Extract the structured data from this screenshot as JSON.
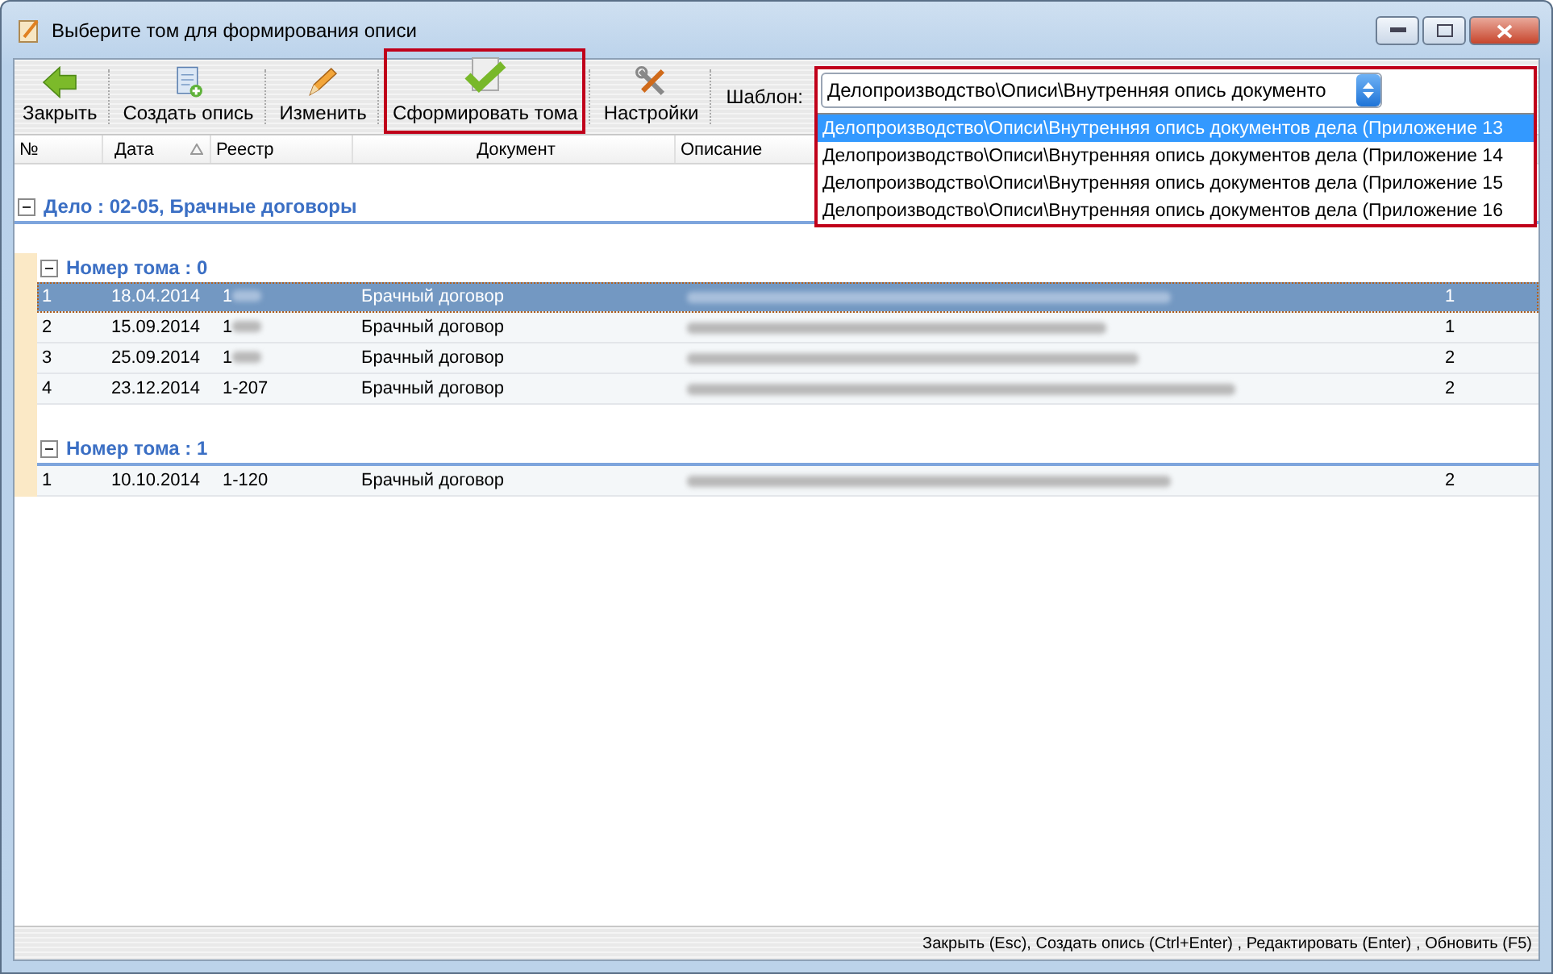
{
  "window": {
    "title": "Выберите том для формирования описи"
  },
  "toolbar": {
    "buttons": [
      {
        "kind": "back",
        "label": "Закрыть",
        "highlighted": false
      },
      {
        "kind": "create",
        "label": "Создать опись",
        "highlighted": false
      },
      {
        "kind": "edit",
        "label": "Изменить",
        "highlighted": false
      },
      {
        "kind": "form",
        "label": "Сформировать тома",
        "highlighted": true
      },
      {
        "kind": "settings",
        "label": "Настройки",
        "highlighted": false
      }
    ],
    "template": {
      "label": "Шаблон:",
      "value": "Делопроизводство\\Описи\\Внутренняя опись документо",
      "expanded": true,
      "highlighted": true,
      "options": [
        {
          "label": "Делопроизводство\\Описи\\Внутренняя опись документов дела (Приложение 13",
          "selected": true
        },
        {
          "label": "Делопроизводство\\Описи\\Внутренняя опись документов дела (Приложение 14",
          "selected": false
        },
        {
          "label": "Делопроизводство\\Описи\\Внутренняя опись документов дела (Приложение 15",
          "selected": false
        },
        {
          "label": "Делопроизводство\\Описи\\Внутренняя опись документов дела (Приложение 16",
          "selected": false
        }
      ]
    }
  },
  "table": {
    "columns": [
      {
        "label": "№",
        "sorted": false
      },
      {
        "label": "Дата",
        "sorted": true
      },
      {
        "label": "Реестр",
        "sorted": false
      },
      {
        "label": "Документ",
        "sorted": false
      },
      {
        "label": "Описание",
        "sorted": false
      }
    ],
    "groups": [
      {
        "label": "Дело : 02-05, Брачные договоры",
        "expanded": true,
        "children": [
          {
            "label": "Номер тома : 0",
            "expanded": true,
            "rows": [
              {
                "number": "1",
                "date": "18.04.2014",
                "registry": "1",
                "registry_redacted": true,
                "document": "Брачный договор",
                "description_redacted": true,
                "column_6": "1",
                "selected": true
              },
              {
                "number": "2",
                "date": "15.09.2014",
                "registry": "1",
                "registry_redacted": true,
                "document": "Брачный договор",
                "description_redacted": true,
                "column_6": "1",
                "selected": false
              },
              {
                "number": "3",
                "date": "25.09.2014",
                "registry": "1",
                "registry_redacted": true,
                "document": "Брачный договор",
                "description_redacted": true,
                "column_6": "2",
                "selected": false
              },
              {
                "number": "4",
                "date": "23.12.2014",
                "registry": "1-207",
                "registry_redacted": false,
                "document": "Брачный договор",
                "description_redacted": true,
                "column_6": "2",
                "selected": false
              }
            ]
          },
          {
            "label": "Номер тома : 1",
            "expanded": true,
            "rows": [
              {
                "number": "1",
                "date": "10.10.2014",
                "registry": "1-120",
                "registry_redacted": false,
                "document": "Брачный договор",
                "description_redacted": true,
                "column_6": "2",
                "selected": false
              }
            ]
          }
        ]
      }
    ]
  },
  "status_bar": "Закрыть (Esc), Создать опись (Ctrl+Enter) , Редактировать (Enter) , Обновить (F5)"
}
